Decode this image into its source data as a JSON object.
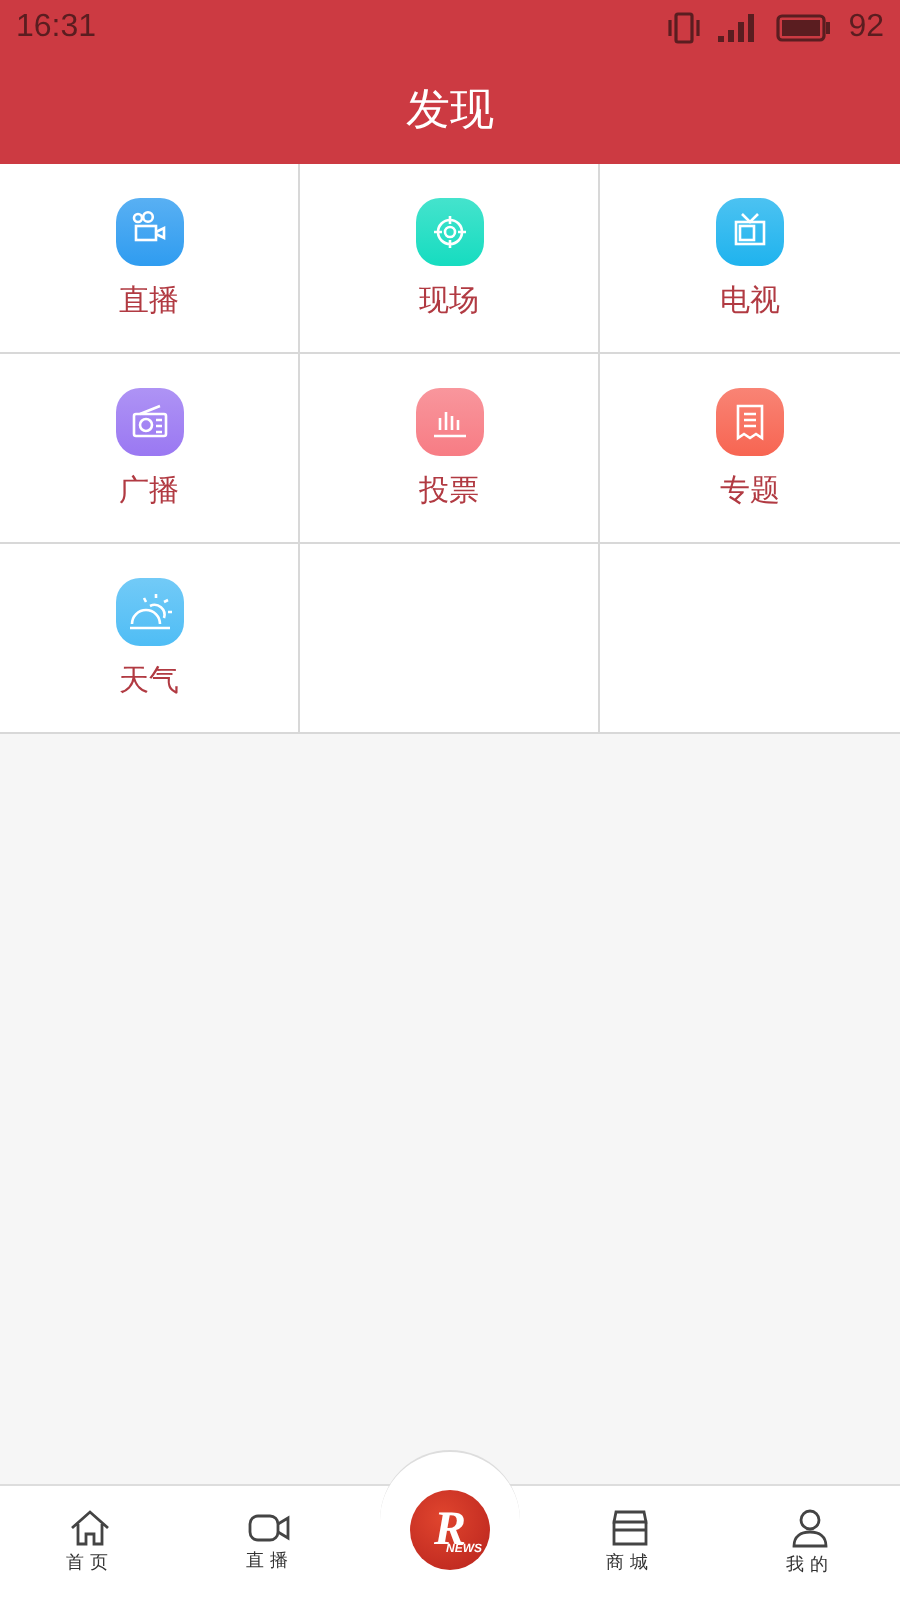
{
  "status_bar": {
    "time": "16:31",
    "battery": "92"
  },
  "header": {
    "title": "发现"
  },
  "grid": [
    {
      "label": "直播",
      "kind": "camera",
      "color": "#2f9cf0"
    },
    {
      "label": "现场",
      "kind": "target",
      "color": "#16dcc0"
    },
    {
      "label": "电视",
      "kind": "tv",
      "color": "#1fb3ee"
    },
    {
      "label": "广播",
      "kind": "radio",
      "color": "#9a78f2"
    },
    {
      "label": "投票",
      "kind": "chart",
      "color": "#f77c84"
    },
    {
      "label": "专题",
      "kind": "doc",
      "color": "#f76552"
    },
    {
      "label": "天气",
      "kind": "weather",
      "color": "#4fbdf5"
    }
  ],
  "tab_bar": {
    "tabs": [
      {
        "label": "首页",
        "kind": "home"
      },
      {
        "label": "直播",
        "kind": "video"
      },
      {
        "kind": "logo",
        "letter": "R",
        "word": "NEWS"
      },
      {
        "label": "商城",
        "kind": "shop"
      },
      {
        "label": "我的",
        "kind": "user"
      }
    ]
  }
}
